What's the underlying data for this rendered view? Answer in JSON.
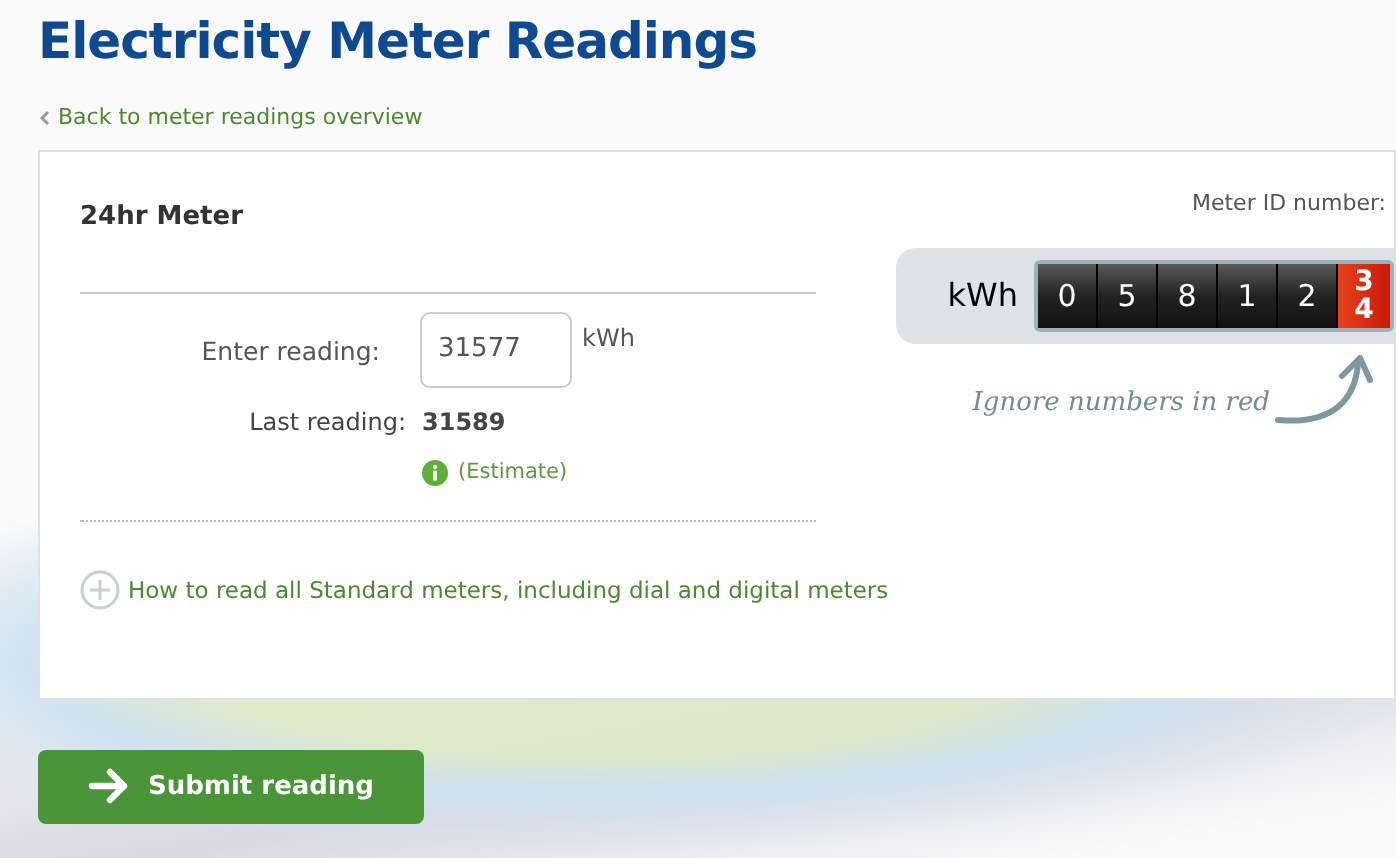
{
  "title": "Electricity Meter Readings",
  "back_link": "Back to meter readings overview",
  "meter": {
    "name": "24hr Meter",
    "id_label": "Meter ID number:"
  },
  "reading": {
    "label": "Enter reading:",
    "value": "31577",
    "unit": "kWh"
  },
  "last_reading": {
    "label": "Last reading:",
    "value": "31589",
    "note": "(Estimate)"
  },
  "help_link": "How to read all Standard meters, including dial and digital meters",
  "meter_display": {
    "unit": "kWh",
    "digits": [
      "0",
      "5",
      "8",
      "1",
      "2"
    ],
    "red_digits": [
      "3",
      "4"
    ],
    "hint": "Ignore numbers in red"
  },
  "submit_button": "Submit reading"
}
